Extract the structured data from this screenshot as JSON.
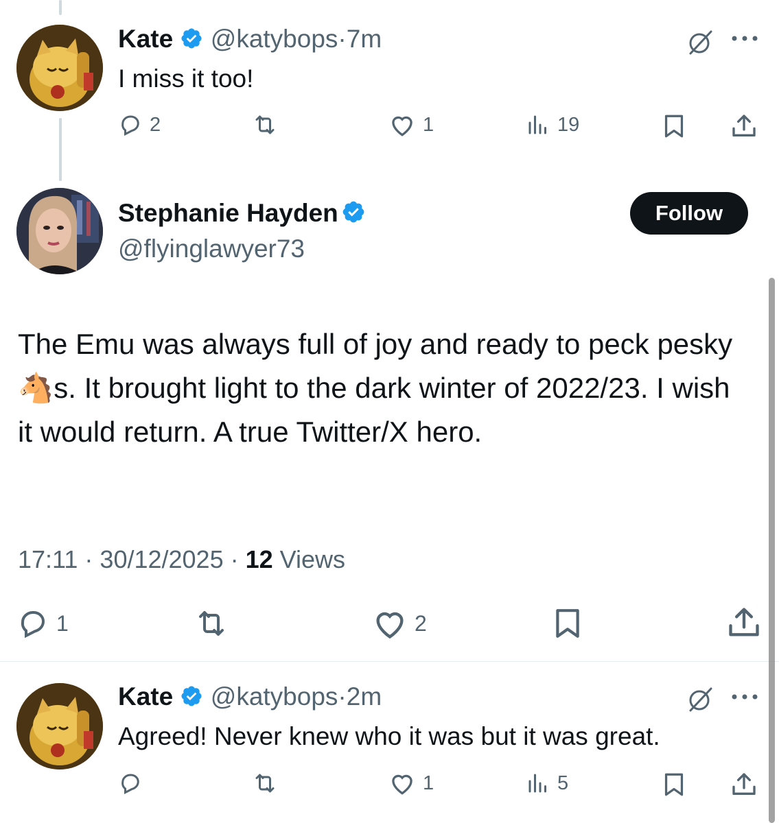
{
  "tweets": {
    "reply1": {
      "name": "Kate",
      "handle": "@katybops",
      "sep": "·",
      "time": "7m",
      "text": "I miss it too!",
      "replies": "2",
      "reposts": "",
      "likes": "1",
      "views": "19"
    },
    "main": {
      "name": "Stephanie Hayden",
      "handle": "@flyinglawyer73",
      "follow_label": "Follow",
      "text_a": "The Emu was always full of joy and ready to peck pesky ",
      "emoji": "🐴",
      "text_b": "s. It brought light to the dark winter of 2022/23. I wish it would return. A true Twitter/X hero.",
      "time": "17:11",
      "date": "30/12/2025",
      "views_count": "12",
      "views_label": "Views",
      "replies": "1",
      "reposts": "",
      "likes": "2"
    },
    "reply2": {
      "name": "Kate",
      "handle": "@katybops",
      "sep": "·",
      "time": "2m",
      "text": "Agreed! Never knew who it was but it was great.",
      "replies": "",
      "reposts": "",
      "likes": "1",
      "views": "5"
    }
  },
  "colors": {
    "text": "#0f1419",
    "muted": "#536471",
    "verified": "#1d9bf0",
    "follow_bg": "#0f1419",
    "follow_text": "#ffffff"
  },
  "icons": [
    "reply-icon",
    "repost-icon",
    "like-icon",
    "views-icon",
    "bookmark-icon",
    "share-icon",
    "grok-icon",
    "more-icon",
    "verified-badge-icon"
  ]
}
